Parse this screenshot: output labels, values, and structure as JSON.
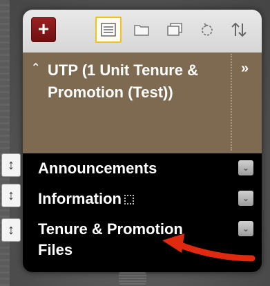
{
  "toolbar": {
    "add_icon": "plus-icon",
    "icons": [
      {
        "name": "list-view-icon",
        "active": true
      },
      {
        "name": "folder-icon",
        "active": false
      },
      {
        "name": "windows-icon",
        "active": false
      },
      {
        "name": "refresh-icon",
        "active": false
      },
      {
        "name": "sort-icon",
        "active": false
      }
    ]
  },
  "course": {
    "title": "UTP (1 Unit Tenure & Promotion (Test))",
    "expand_label": "»",
    "collapse_label": "⌃"
  },
  "menu": {
    "items": [
      {
        "label": "Announcements"
      },
      {
        "label": "Information"
      },
      {
        "label": "Tenure & Promotion Files"
      }
    ]
  },
  "colors": {
    "add_button": "#8a1a1a",
    "course_bar": "#7d6a50",
    "menu_bg": "#000000",
    "active_outline": "#f1c21b",
    "arrow": "#e02a10"
  }
}
